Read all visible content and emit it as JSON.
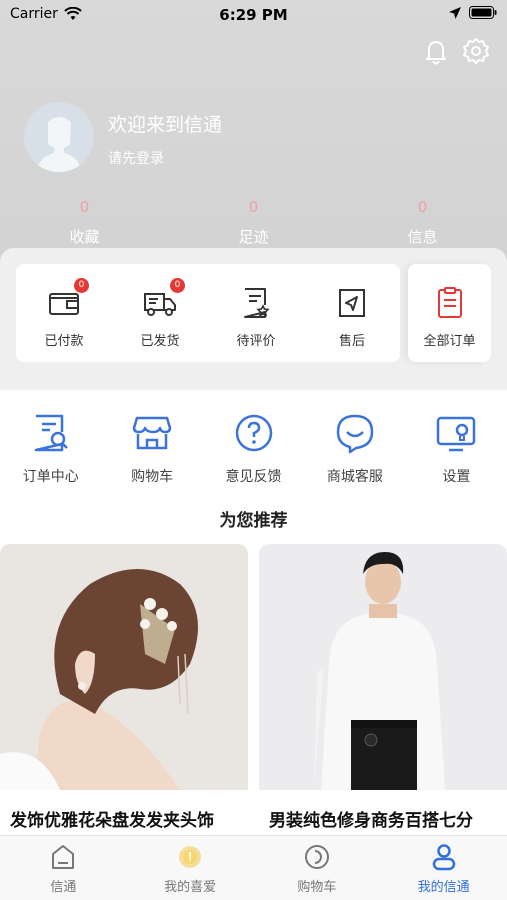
{
  "status_bar": {
    "carrier": "Carrier",
    "time": "6:29 PM"
  },
  "profile": {
    "welcome": "欢迎来到信通",
    "login_prompt": "请先登录"
  },
  "stats": [
    {
      "value": "0",
      "label": "收藏"
    },
    {
      "value": "0",
      "label": "足迹"
    },
    {
      "value": "0",
      "label": "信息"
    }
  ],
  "orders": {
    "items": [
      {
        "label": "已付款",
        "badge": "0"
      },
      {
        "label": "已发货",
        "badge": "0"
      },
      {
        "label": "待评价"
      },
      {
        "label": "售后"
      }
    ],
    "all_label": "全部订单"
  },
  "services": [
    {
      "label": "订单中心",
      "icon": "order-center-icon"
    },
    {
      "label": "购物车",
      "icon": "shop-icon"
    },
    {
      "label": "意见反馈",
      "icon": "feedback-icon"
    },
    {
      "label": "商城客服",
      "icon": "customer-service-icon"
    },
    {
      "label": "设置",
      "icon": "settings-screen-icon"
    }
  ],
  "recommend": {
    "title": "为您推荐",
    "products": [
      {
        "name": "发饰优雅花朵盘发发夹头饰"
      },
      {
        "name": "男装纯色修身商务百搭七分"
      }
    ]
  },
  "tabbar": [
    {
      "label": "信通"
    },
    {
      "label": "我的喜爱"
    },
    {
      "label": "购物车"
    },
    {
      "label": "我的信通"
    }
  ],
  "colors": {
    "accent": "#2f6fe0",
    "badge": "#e53935",
    "all_orders_icon": "#e53935",
    "icon_blue": "#3a73d9"
  }
}
